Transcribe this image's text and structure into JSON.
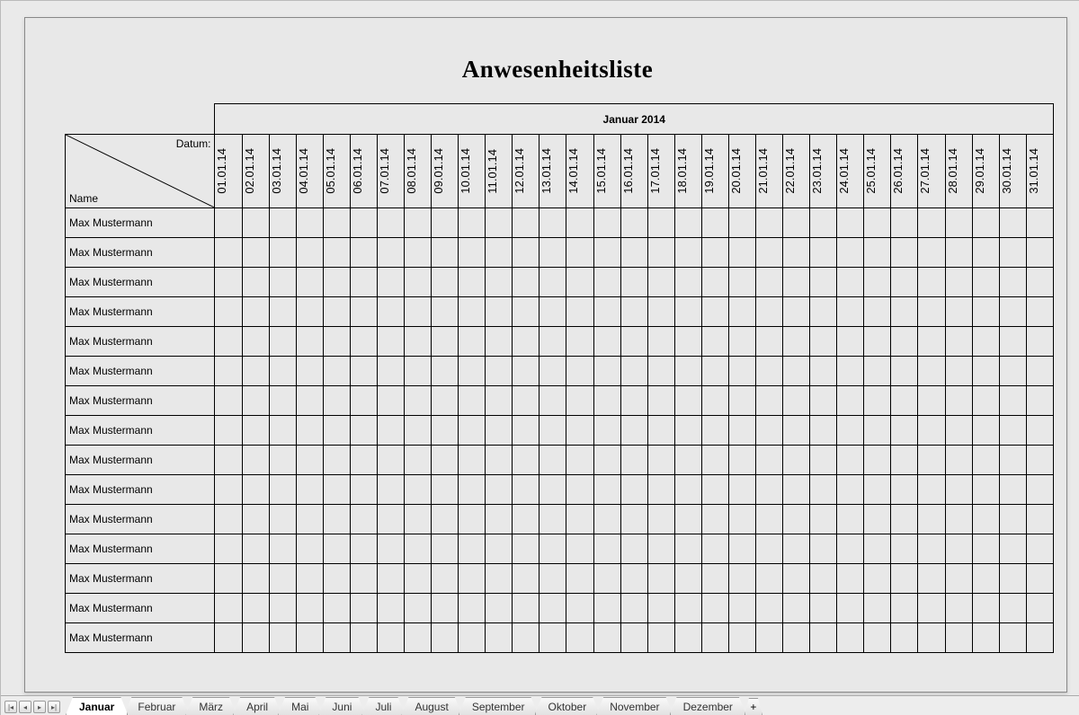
{
  "title": "Anwesenheitsliste",
  "month_header": "Januar 2014",
  "header": {
    "datum": "Datum:",
    "name": "Name"
  },
  "dates": [
    "01.01.14",
    "02.01.14",
    "03.01.14",
    "04.01.14",
    "05.01.14",
    "06.01.14",
    "07.01.14",
    "08.01.14",
    "09.01.14",
    "10.01.14",
    "11.01.14",
    "12.01.14",
    "13.01.14",
    "14.01.14",
    "15.01.14",
    "16.01.14",
    "17.01.14",
    "18.01.14",
    "19.01.14",
    "20.01.14",
    "21.01.14",
    "22.01.14",
    "23.01.14",
    "24.01.14",
    "25.01.14",
    "26.01.14",
    "27.01.14",
    "28.01.14",
    "29.01.14",
    "30.01.14",
    "31.01.14"
  ],
  "names": [
    "Max Mustermann",
    "Max Mustermann",
    "Max Mustermann",
    "Max Mustermann",
    "Max Mustermann",
    "Max Mustermann",
    "Max Mustermann",
    "Max Mustermann",
    "Max Mustermann",
    "Max Mustermann",
    "Max Mustermann",
    "Max Mustermann",
    "Max Mustermann",
    "Max Mustermann",
    "Max Mustermann"
  ],
  "tabs": [
    "Januar",
    "Februar",
    "März",
    "April",
    "Mai",
    "Juni",
    "Juli",
    "August",
    "September",
    "Oktober",
    "November",
    "Dezember"
  ],
  "active_tab": "Januar",
  "plus": "+"
}
